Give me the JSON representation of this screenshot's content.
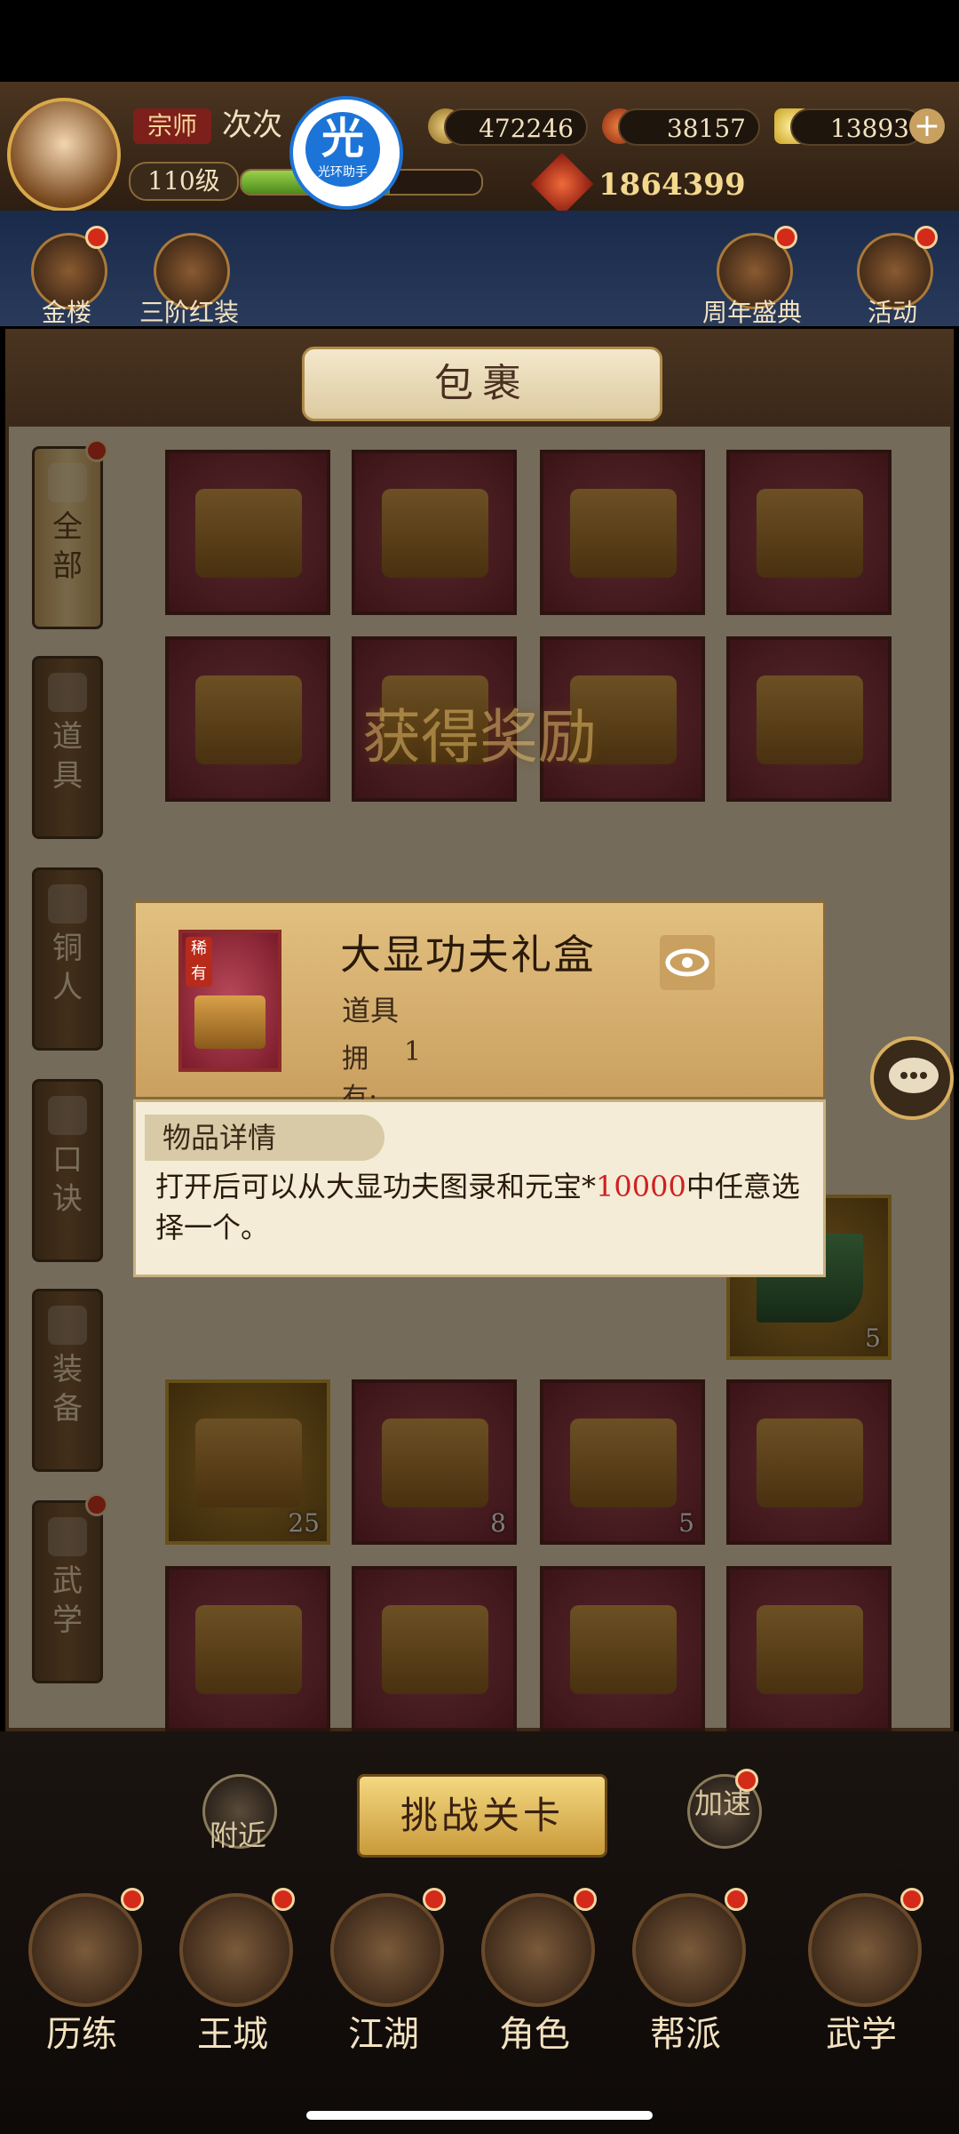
{
  "player": {
    "rank": "宗师",
    "name": "次次",
    "level": "110级",
    "xp_fraction": 0.62,
    "power": "1864399"
  },
  "helper": {
    "glyph": "光",
    "label": "光环助手"
  },
  "currencies": [
    {
      "icon": "copper-coin-icon",
      "value": "472246"
    },
    {
      "icon": "gold-ingot-icon",
      "value": "38157"
    },
    {
      "icon": "yuanbao-icon",
      "value": "13893"
    }
  ],
  "shortcuts": [
    {
      "label": "金楼",
      "badge": true
    },
    {
      "label": "三阶红装",
      "badge": false
    },
    {
      "label": "周年盛典",
      "badge": true
    },
    {
      "label": "活动",
      "badge": true
    }
  ],
  "bag": {
    "title": "包裹",
    "tabs": [
      {
        "label": "全部",
        "active": true,
        "badge": true
      },
      {
        "label": "道具",
        "active": false,
        "badge": false
      },
      {
        "label": "铜人",
        "active": false,
        "badge": false
      },
      {
        "label": "口诀",
        "active": false,
        "badge": false
      },
      {
        "label": "装备",
        "active": false,
        "badge": false
      },
      {
        "label": "武学",
        "active": false,
        "badge": true
      }
    ],
    "slots": [
      {
        "qty": "",
        "gold": false
      },
      {
        "qty": "",
        "gold": false
      },
      {
        "qty": "",
        "gold": false
      },
      {
        "qty": "",
        "gold": false
      },
      {
        "qty": "",
        "gold": false
      },
      {
        "qty": "",
        "gold": false
      },
      {
        "qty": "",
        "gold": false
      },
      {
        "qty": "",
        "gold": false
      },
      {
        "qty": "25",
        "gold": true
      },
      {
        "qty": "8",
        "gold": false
      },
      {
        "qty": "5",
        "gold": false
      },
      {
        "qty": "",
        "gold": false
      },
      {
        "qty": "",
        "gold": false
      },
      {
        "qty": "",
        "gold": false
      },
      {
        "qty": "",
        "gold": false
      },
      {
        "qty": "",
        "gold": false
      }
    ],
    "jade_qty": "5",
    "reward_banner": "获得奖励"
  },
  "popup": {
    "tag": "稀有",
    "name": "大显功夫礼盒",
    "type": "道具",
    "own_label": "拥有:",
    "own_value": "1",
    "detail_tab": "物品详情",
    "detail_prefix": "打开后可以从大显功夫图录和元宝*",
    "detail_highlight": "10000",
    "detail_suffix": "中任意选择一个。"
  },
  "actions": {
    "challenge": "挑战关卡",
    "nearby": "附近",
    "speedup": "加速"
  },
  "nav": [
    {
      "label": "历练",
      "badge": true
    },
    {
      "label": "王城",
      "badge": true
    },
    {
      "label": "江湖",
      "badge": true
    },
    {
      "label": "角色",
      "badge": true
    },
    {
      "label": "帮派",
      "badge": true
    },
    {
      "label": "武学",
      "badge": true
    }
  ]
}
